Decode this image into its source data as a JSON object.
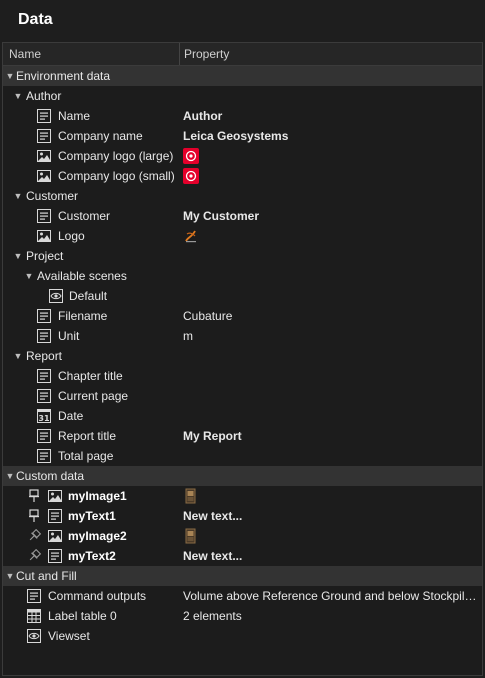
{
  "panel": {
    "title": "Data"
  },
  "header": {
    "name": "Name",
    "property": "Property"
  },
  "colors": {
    "group_bg": "#333333",
    "logo_red": "#e4002b",
    "background": "#1c1c1c"
  },
  "tree": {
    "environment": {
      "label": "Environment data",
      "author": {
        "label": "Author",
        "name": {
          "label": "Name",
          "value": "Author",
          "icon": "text-field-icon"
        },
        "company_name": {
          "label": "Company name",
          "value": "Leica Geosystems",
          "icon": "text-field-icon"
        },
        "logo_large": {
          "label": "Company logo (large)",
          "icon": "image-icon"
        },
        "logo_small": {
          "label": "Company logo (small)",
          "icon": "image-icon"
        }
      },
      "customer": {
        "label": "Customer",
        "customer": {
          "label": "Customer",
          "value": "My Customer",
          "icon": "text-field-icon"
        },
        "logo": {
          "label": "Logo",
          "icon": "image-icon"
        }
      },
      "project": {
        "label": "Project",
        "available_scenes": {
          "label": "Available scenes",
          "default": {
            "label": "Default",
            "icon": "eye-icon"
          }
        },
        "filename": {
          "label": "Filename",
          "value": "Cubature",
          "icon": "text-field-icon"
        },
        "unit": {
          "label": "Unit",
          "value": "m",
          "icon": "text-field-icon"
        }
      },
      "report": {
        "label": "Report",
        "chapter_title": {
          "label": "Chapter title",
          "icon": "text-field-icon"
        },
        "current_page": {
          "label": "Current page",
          "icon": "text-field-icon"
        },
        "date": {
          "label": "Date",
          "icon": "calendar-icon",
          "icon_text": "31"
        },
        "report_title": {
          "label": "Report title",
          "value": "My Report",
          "icon": "text-field-icon"
        },
        "total_page": {
          "label": "Total page",
          "icon": "text-field-icon"
        }
      }
    },
    "custom": {
      "label": "Custom data",
      "items": [
        {
          "label": "myImage1",
          "value": "",
          "pinned": true,
          "icon": "image-icon"
        },
        {
          "label": "myText1",
          "value": "New text...",
          "pinned": true,
          "icon": "text-field-icon"
        },
        {
          "label": "myImage2",
          "value": "",
          "pinned": false,
          "icon": "image-icon"
        },
        {
          "label": "myText2",
          "value": "New text...",
          "pinned": false,
          "icon": "text-field-icon"
        }
      ]
    },
    "cut_fill": {
      "label": "Cut and Fill",
      "command_outputs": {
        "label": "Command outputs",
        "value": "Volume above Reference Ground and below Stockpile:...",
        "icon": "text-field-icon"
      },
      "label_table": {
        "label": "Label table 0",
        "value": "2 elements",
        "icon": "table-icon"
      },
      "viewset": {
        "label": "Viewset",
        "icon": "eye-icon"
      }
    }
  }
}
